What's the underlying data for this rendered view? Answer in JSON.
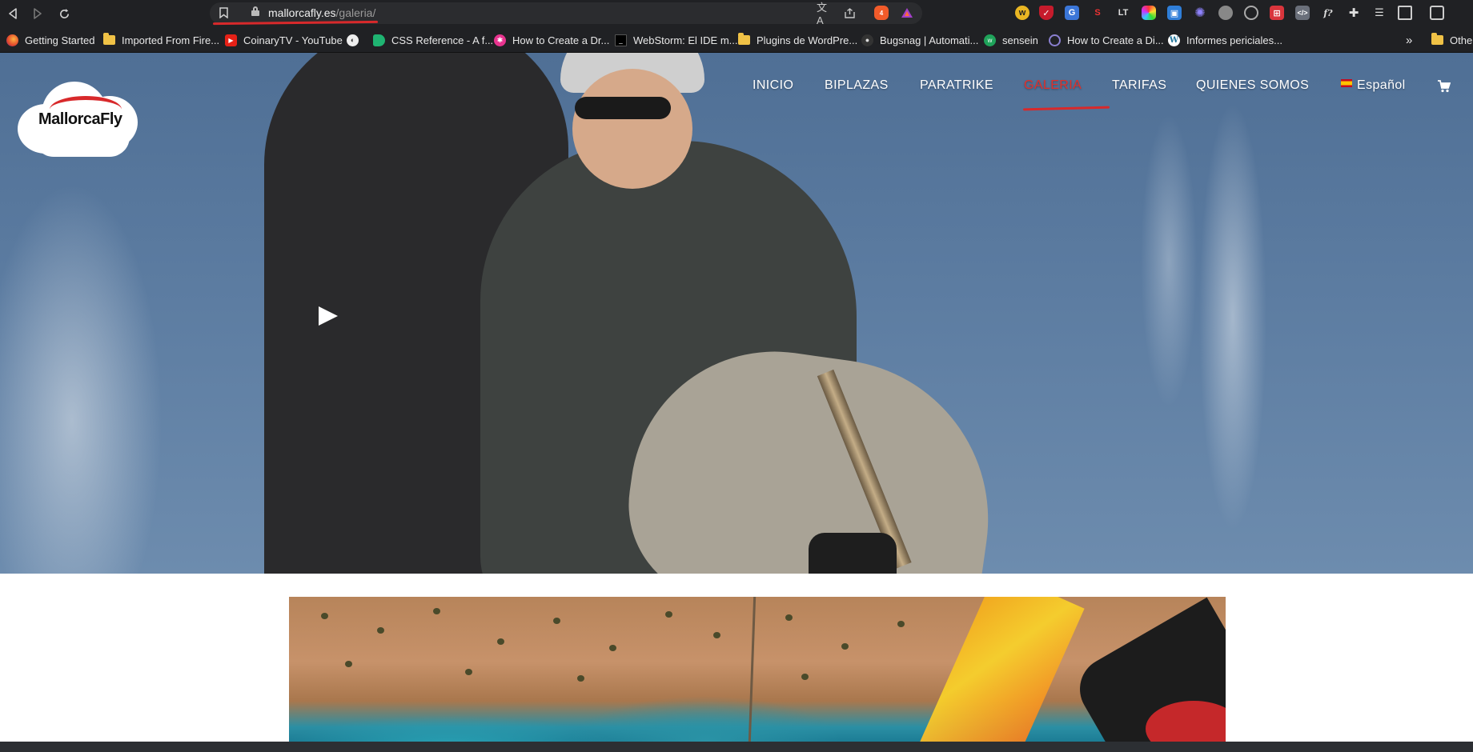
{
  "browser": {
    "url_domain": "mallorcafly.es",
    "url_path": "/galeria/",
    "extension_badge": "4"
  },
  "bookmarks": [
    {
      "label": "Getting Started",
      "icon": "firefox-icon"
    },
    {
      "label": "Imported From Fire...",
      "icon": "folder-icon"
    },
    {
      "label": "CoinaryTV - YouTube",
      "icon": "youtube-icon"
    },
    {
      "label": "",
      "icon": "globe-icon"
    },
    {
      "label": "CSS Reference - A f...",
      "icon": "css-reference-icon"
    },
    {
      "label": "How to Create a Dr...",
      "icon": "asterisk-icon"
    },
    {
      "label": "WebStorm: El IDE m...",
      "icon": "webstorm-icon"
    },
    {
      "label": "Plugins de WordPre...",
      "icon": "folder-icon"
    },
    {
      "label": "Bugsnag | Automati...",
      "icon": "bugsnag-icon"
    },
    {
      "label": "sensein",
      "icon": "sensein-icon"
    },
    {
      "label": "How to Create a Di...",
      "icon": "swirl-icon"
    },
    {
      "label": "Informes periciales...",
      "icon": "wordpress-icon"
    }
  ],
  "bookmarks_overflow": "»",
  "bookmarks_other": "Other",
  "site": {
    "logo_text": "MallorcaFly",
    "nav": [
      {
        "label": "INICIO"
      },
      {
        "label": "BIPLAZAS"
      },
      {
        "label": "PARATRIKE"
      },
      {
        "label": "GALERIA"
      },
      {
        "label": "TARIFAS"
      },
      {
        "label": "QUIENES SOMOS"
      },
      {
        "label": "Español"
      }
    ],
    "active_nav": "GALERIA",
    "accent_color": "#d8292b"
  }
}
